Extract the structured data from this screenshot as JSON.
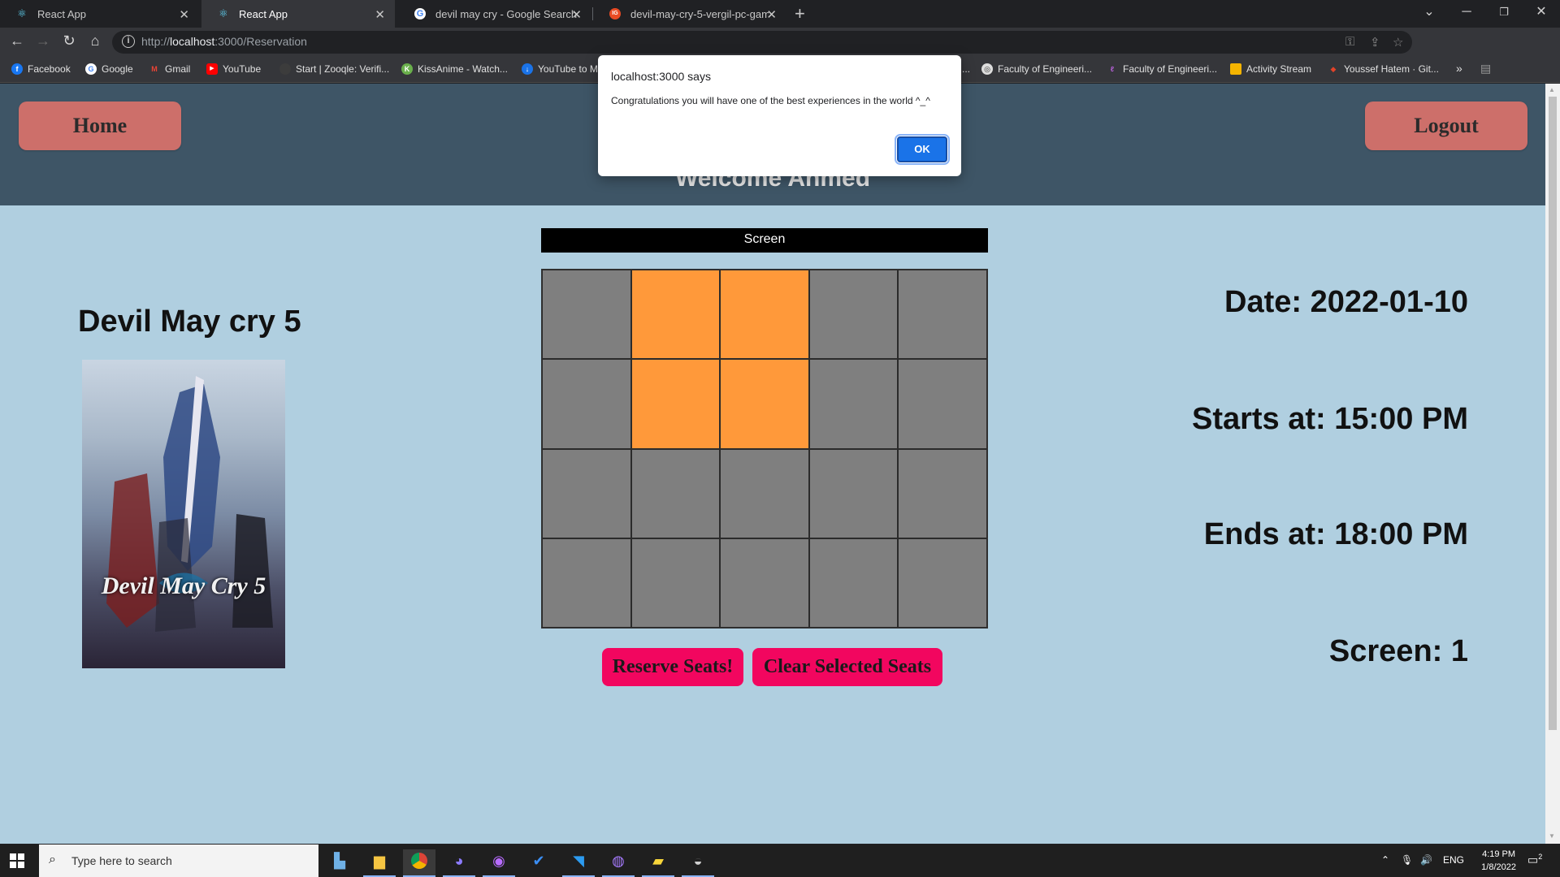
{
  "browser": {
    "tabs": [
      {
        "title": "React App",
        "icon": "react-icon"
      },
      {
        "title": "React App",
        "icon": "react-icon"
      },
      {
        "title": "devil may cry - Google Search",
        "icon": "google-icon"
      },
      {
        "title": "devil-may-cry-5-vergil-pc-game-",
        "icon": "ign-icon"
      }
    ],
    "url_prefix": "http://",
    "url_host": "localhost",
    "url_rest": ":3000/Reservation",
    "bookmarks": [
      {
        "label": "Facebook",
        "color": "#1877f2",
        "glyph": "f"
      },
      {
        "label": "Google",
        "color": "#ffffff",
        "glyph": "G"
      },
      {
        "label": "Gmail",
        "color": "#ea4335",
        "glyph": "M"
      },
      {
        "label": "YouTube",
        "color": "#ff0000",
        "glyph": "▶"
      },
      {
        "label": "Start | Zooqle: Verifi...",
        "color": "#3c3c3c",
        "glyph": ""
      },
      {
        "label": "KissAnime - Watch...",
        "color": "#6ab04c",
        "glyph": "K"
      },
      {
        "label": "YouTube to M",
        "color": "#1a73e8",
        "glyph": "↓"
      },
      {
        "label": "...",
        "color": "#35363a",
        "glyph": ""
      },
      {
        "label": "Faculty of Engineeri...",
        "color": "#dddddd",
        "glyph": "◎"
      },
      {
        "label": "Faculty of Engineeri...",
        "color": "#9c27b0",
        "glyph": "ℓ"
      },
      {
        "label": "Activity Stream",
        "color": "#f4b400",
        "glyph": "◩"
      },
      {
        "label": "Youssef Hatem · Git...",
        "color": "#e24329",
        "glyph": "◆"
      }
    ],
    "more_bookmarks": "»"
  },
  "page": {
    "home_label": "Home",
    "logout_label": "Logout",
    "welcome": "Welcome Ahmed",
    "movie_title": "Devil May cry 5",
    "poster_logo": "Devil May Cry 5",
    "screen_label": "Screen",
    "seat_grid": {
      "rows": 4,
      "cols": 5,
      "selected": [
        [
          0,
          1
        ],
        [
          0,
          2
        ],
        [
          1,
          1
        ],
        [
          1,
          2
        ]
      ]
    },
    "reserve_label": "Reserve Seats!",
    "clear_label": "Clear Selected Seats",
    "date": "Date: 2022-01-10",
    "starts": "Starts at: 15:00 PM",
    "ends": "Ends at: 18:00 PM",
    "screen": "Screen: 1",
    "colors": {
      "header": "#3e5566",
      "background": "#b0cfe0",
      "nav_button": "#cd6f6a",
      "seat_available": "#7f7f7f",
      "seat_selected": "#ff993a",
      "action_button": "#f2065f"
    }
  },
  "alert": {
    "title": "localhost:3000 says",
    "message": "Congratulations you will have one of the best experiences in the world ^_^",
    "ok_label": "OK"
  },
  "taskbar": {
    "search_placeholder": "Type here to search",
    "language": "ENG",
    "time": "4:19 PM",
    "date": "1/8/2022",
    "notifications": "2"
  }
}
